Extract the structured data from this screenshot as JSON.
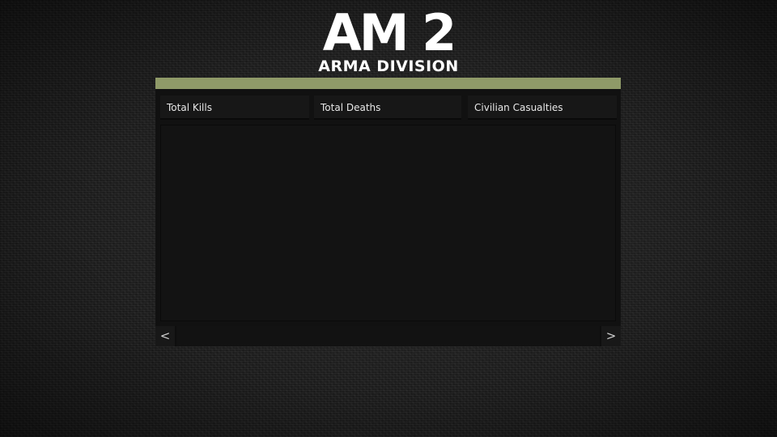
{
  "logo": {
    "mark": "AM 2",
    "subtitle": "ARMA DIVISION"
  },
  "colors": {
    "accent_bar": "#8f9a68",
    "panel_background": "#111111",
    "text": "#e8e8e8"
  },
  "tabs": [
    {
      "label": "Total Kills"
    },
    {
      "label": "Total Deaths"
    },
    {
      "label": "Civilian Casualties"
    }
  ],
  "pager": {
    "prev_label": "<",
    "next_label": ">"
  }
}
